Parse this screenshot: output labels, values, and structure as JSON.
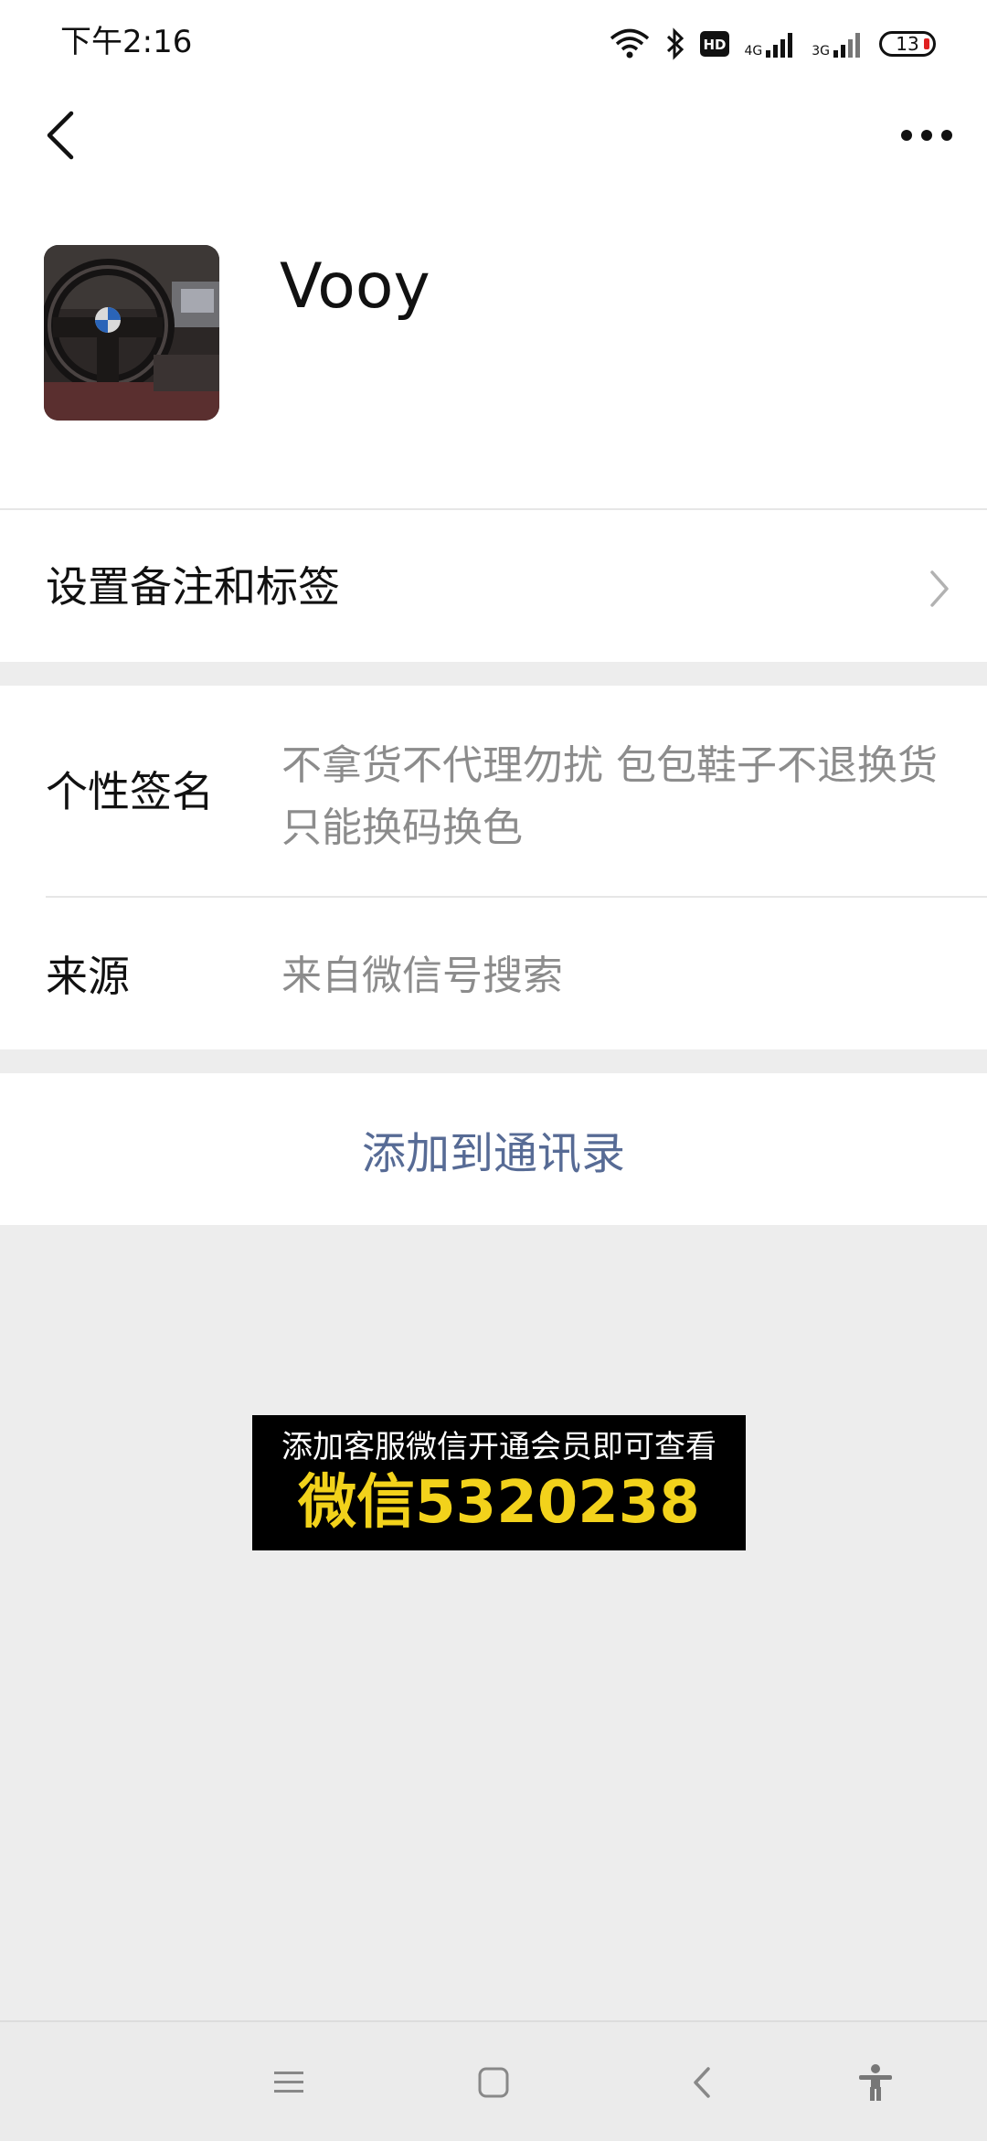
{
  "status_bar": {
    "time": "下午2:16",
    "network_1": "4G",
    "network_2": "3G",
    "battery": "13"
  },
  "profile": {
    "name": "Vooy",
    "avatar_description": "car-steering-wheel-photo"
  },
  "remark_row": {
    "label": "设置备注和标签"
  },
  "signature": {
    "label": "个性签名",
    "value": "不拿货不代理勿扰  包包鞋子不退换货 只能换码换色"
  },
  "source": {
    "label": "来源",
    "value": "来自微信号搜索"
  },
  "add_contact": {
    "label": "添加到通讯录"
  },
  "banner": {
    "top": "添加客服微信开通会员即可查看",
    "main": "微信5320238"
  },
  "colors": {
    "link": "#576b95",
    "banner_text": "#f2d21b",
    "background": "#ededed"
  },
  "icons": {
    "back": "chevron-left-icon",
    "more": "more-dots-icon",
    "chevron": "chevron-right-icon",
    "nav_menu": "menu-icon",
    "nav_home": "home-square-icon",
    "nav_back": "back-triangle-icon",
    "nav_accessibility": "accessibility-icon"
  }
}
